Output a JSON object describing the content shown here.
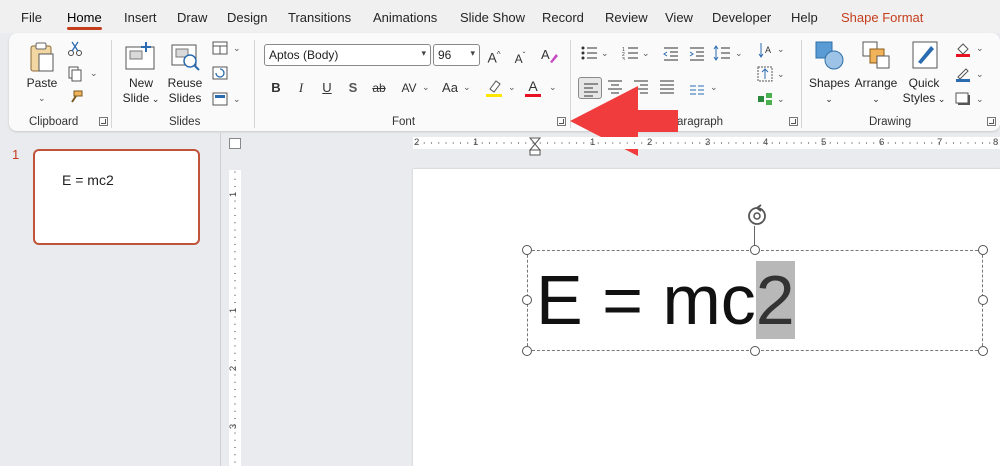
{
  "menu": {
    "tabs": [
      "File",
      "Home",
      "Insert",
      "Draw",
      "Design",
      "Transitions",
      "Animations",
      "Slide Show",
      "Record",
      "Review",
      "View",
      "Developer",
      "Help",
      "Shape Format"
    ],
    "active": "Home"
  },
  "clipboard": {
    "paste_label": "Paste",
    "group_label": "Clipboard"
  },
  "slides": {
    "new_slide_line1": "New",
    "new_slide_line2": "Slide",
    "reuse_line1": "Reuse",
    "reuse_line2": "Slides",
    "group_label": "Slides"
  },
  "font": {
    "family_value": "Aptos (Body)",
    "size_value": "96",
    "bold": "B",
    "italic": "I",
    "underline": "U",
    "shadow": "S",
    "strike": "ab",
    "spacing": "AV",
    "case": "Aa",
    "grow": "A",
    "shrink": "A",
    "color_letter": "A",
    "group_label": "Font"
  },
  "paragraph": {
    "group_label": "aragraph"
  },
  "drawing": {
    "shapes_label": "Shapes",
    "arrange_label": "Arrange",
    "quick_line1": "Quick",
    "quick_line2": "Styles",
    "group_label": "Drawing"
  },
  "thumbnail": {
    "number": "1",
    "text": "E = mc2"
  },
  "ruler": {
    "h_numbers": [
      "2",
      "1",
      "1",
      "2",
      "3",
      "4",
      "5",
      "6",
      "7",
      "8"
    ],
    "v_numbers": [
      "1",
      "1",
      "2",
      "3"
    ]
  },
  "slide": {
    "equation_main": "E = mc",
    "equation_selected": "2"
  },
  "colors": {
    "accent": "#c43e1c",
    "highlight": "#ffe600",
    "font_color": "#e81123",
    "arrow": "#f03c3c"
  }
}
